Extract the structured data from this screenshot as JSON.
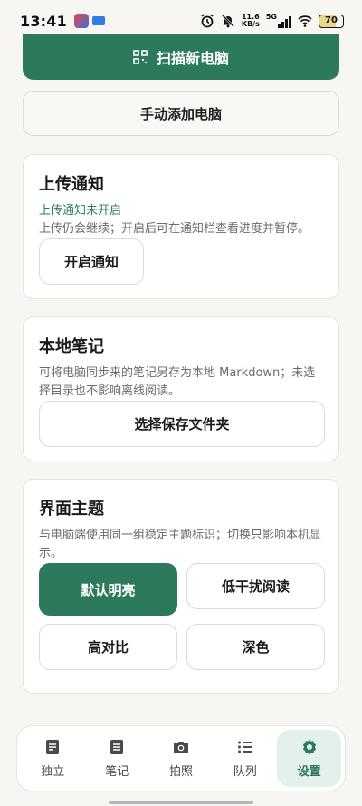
{
  "status_bar": {
    "time": "13:41",
    "net_speed_value": "11.6",
    "net_speed_unit": "KB/s",
    "network": "5G",
    "battery": "70"
  },
  "top_actions": {
    "scan_label": "扫描新电脑",
    "manual_add_label": "手动添加电脑"
  },
  "upload_card": {
    "title": "上传通知",
    "status": "上传通知未开启",
    "description": "上传仍会继续；开启后可在通知栏查看进度并暂停。",
    "button": "开启通知"
  },
  "notes_card": {
    "title": "本地笔记",
    "description": "可将电脑同步来的笔记另存为本地 Markdown；未选择目录也不影响离线阅读。",
    "button": "选择保存文件夹"
  },
  "theme_card": {
    "title": "界面主题",
    "description": "与电脑端使用同一组稳定主题标识；切换只影响本机显示。",
    "options": [
      {
        "label": "默认明亮",
        "selected": true
      },
      {
        "label": "低干扰阅读",
        "selected": false
      },
      {
        "label": "高对比",
        "selected": false
      },
      {
        "label": "深色",
        "selected": false
      }
    ]
  },
  "bottom_nav": {
    "items": [
      {
        "label": "独立",
        "icon": "document-icon",
        "active": false
      },
      {
        "label": "笔记",
        "icon": "note-icon",
        "active": false
      },
      {
        "label": "拍照",
        "icon": "camera-icon",
        "active": false
      },
      {
        "label": "队列",
        "icon": "list-icon",
        "active": false
      },
      {
        "label": "设置",
        "icon": "gear-icon",
        "active": true
      }
    ]
  },
  "colors": {
    "accent": "#2c7a5b",
    "background": "#f7f6f2",
    "active_nav_bg": "#e4f1eb"
  }
}
